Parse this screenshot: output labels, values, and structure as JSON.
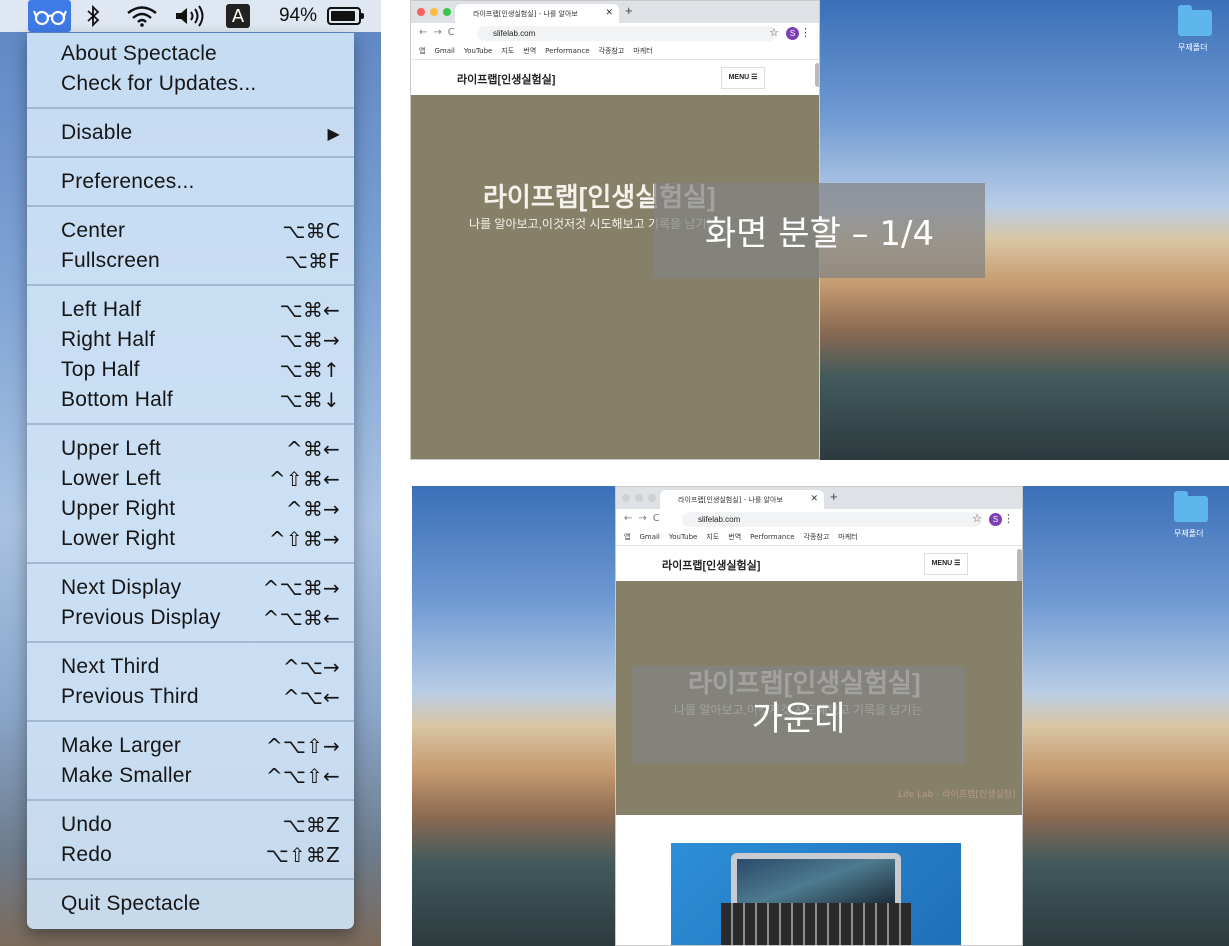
{
  "menubar": {
    "app_icon": "glasses-icon",
    "bluetooth_icon": "bluetooth-icon",
    "wifi_icon": "wifi-icon",
    "volume_icon": "volume-icon",
    "input_source": "A",
    "battery_percent": "94%",
    "battery_level": 0.94
  },
  "menu": {
    "groups": [
      [
        {
          "label": "About Spectacle",
          "shortcut": ""
        },
        {
          "label": "Check for Updates...",
          "shortcut": ""
        }
      ],
      [
        {
          "label": "Disable",
          "shortcut": "▶"
        }
      ],
      [
        {
          "label": "Preferences...",
          "shortcut": ""
        }
      ],
      [
        {
          "label": "Center",
          "shortcut": "⌥⌘C"
        },
        {
          "label": "Fullscreen",
          "shortcut": "⌥⌘F"
        }
      ],
      [
        {
          "label": "Left Half",
          "shortcut": "⌥⌘←"
        },
        {
          "label": "Right Half",
          "shortcut": "⌥⌘→"
        },
        {
          "label": "Top Half",
          "shortcut": "⌥⌘↑"
        },
        {
          "label": "Bottom Half",
          "shortcut": "⌥⌘↓"
        }
      ],
      [
        {
          "label": "Upper Left",
          "shortcut": "^⌘←"
        },
        {
          "label": "Lower Left",
          "shortcut": "^⇧⌘←"
        },
        {
          "label": "Upper Right",
          "shortcut": "^⌘→"
        },
        {
          "label": "Lower Right",
          "shortcut": "^⇧⌘→"
        }
      ],
      [
        {
          "label": "Next Display",
          "shortcut": "^⌥⌘→"
        },
        {
          "label": "Previous Display",
          "shortcut": "^⌥⌘←"
        }
      ],
      [
        {
          "label": "Next Third",
          "shortcut": "^⌥→"
        },
        {
          "label": "Previous Third",
          "shortcut": "^⌥←"
        }
      ],
      [
        {
          "label": "Make Larger",
          "shortcut": "^⌥⇧→"
        },
        {
          "label": "Make Smaller",
          "shortcut": "^⌥⇧←"
        }
      ],
      [
        {
          "label": "Undo",
          "shortcut": "⌥⌘Z"
        },
        {
          "label": "Redo",
          "shortcut": "⌥⇧⌘Z"
        }
      ],
      [
        {
          "label": "Quit Spectacle",
          "shortcut": ""
        }
      ]
    ]
  },
  "desktop": {
    "folder_label": "무제폴더"
  },
  "browser": {
    "tab_title": "라이프랩[인생실험실] - 나를 알아보",
    "url": "slifelab.com",
    "profile_initial": "S",
    "bookmarks": [
      "앱",
      "Gmail",
      "YouTube",
      "지도",
      "번역",
      "Performance",
      "각종참고",
      "마케터"
    ],
    "site_title": "라이프랩[인생실험실]",
    "menu_button": "MENU ☰",
    "hero_title": "라이프랩[인생실험실]",
    "hero_subtitle": "나를 알아보고,이것저것 시도해보고 기록을 남기는",
    "footer_credit": "Life Lab - 라이프랩[인생실험]"
  },
  "overlays": {
    "top": "화면 분할 – 1/4",
    "bottom": "가운데"
  }
}
